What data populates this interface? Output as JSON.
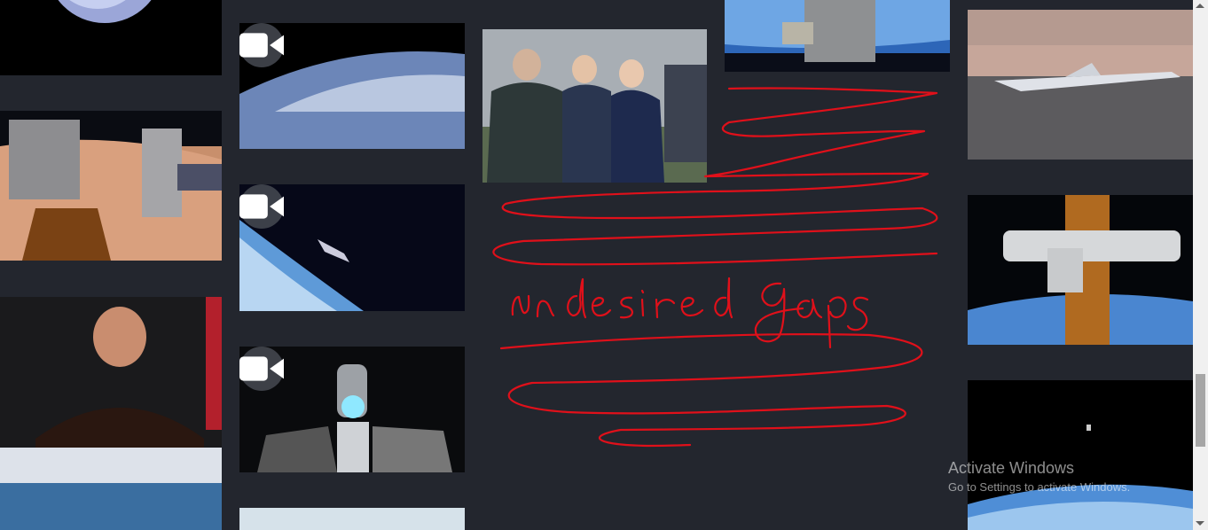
{
  "gallery": {
    "tiles": [
      {
        "type": "image",
        "subject": "earth-globe"
      },
      {
        "type": "image",
        "subject": "spacecraft-docked-over-earth"
      },
      {
        "type": "image",
        "subject": "man-at-press-conference"
      },
      {
        "type": "video",
        "subject": "earth-clouds"
      },
      {
        "type": "video",
        "subject": "capsule-orbiting-earth"
      },
      {
        "type": "video",
        "subject": "lunar-lander"
      },
      {
        "type": "image",
        "subject": "sky-partial"
      },
      {
        "type": "image",
        "subject": "people-group-outdoors"
      },
      {
        "type": "image",
        "subject": "iss-module-over-earth"
      },
      {
        "type": "image",
        "subject": "supersonic-aircraft-on-runway"
      },
      {
        "type": "image",
        "subject": "iss-robotic-arm-solar-array"
      },
      {
        "type": "image",
        "subject": "astronaut-spacewalk-earth"
      }
    ],
    "video_icon": "video-camera-icon"
  },
  "annotation": {
    "text": "undesired gaps",
    "color": "#e0101a"
  },
  "watermark": {
    "line1": "Activate Windows",
    "line2": "Go to Settings to activate Windows."
  }
}
